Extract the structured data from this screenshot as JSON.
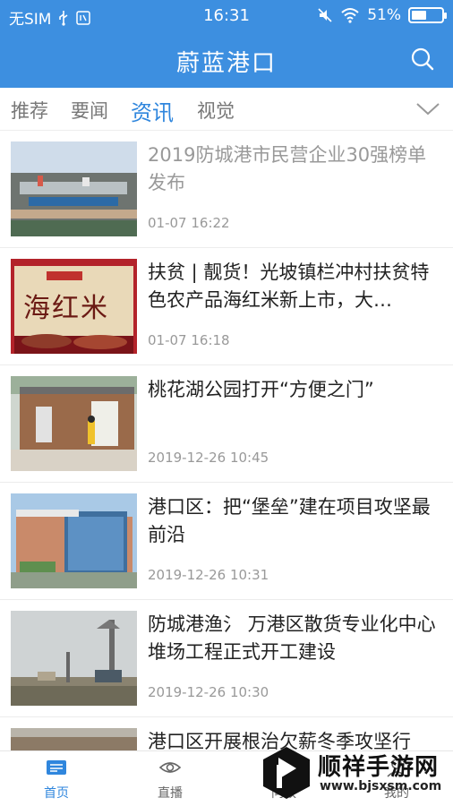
{
  "status_bar": {
    "carrier": "无SIM",
    "time": "16:31",
    "battery": "51%",
    "battery_level": 0.51
  },
  "header": {
    "title": "蔚蓝港口"
  },
  "tabs": [
    {
      "label": "推荐",
      "active": false
    },
    {
      "label": "要闻",
      "active": false
    },
    {
      "label": "资讯",
      "active": true
    },
    {
      "label": "视觉",
      "active": false
    }
  ],
  "articles": [
    {
      "title": "2019防城港市民营企业30强榜单发布",
      "time": "01-07 16:22",
      "read": true
    },
    {
      "title": "扶贫 | 靓货！光坡镇栏冲村扶贫特色农产品海红米新上市，大…",
      "time": "01-07 16:18",
      "read": false
    },
    {
      "title": "桃花湖公园打开“方便之门”",
      "time": "2019-12-26 10:45",
      "read": false
    },
    {
      "title": "港口区：把“堡垒”建在项目攻坚最前沿",
      "time": "2019-12-26 10:31",
      "read": false
    },
    {
      "title": "防城港渔氵 万港区散货专业化中心堆场工程正式开工建设",
      "time": "2019-12-26 10:30",
      "read": false
    },
    {
      "title": "港口区开展根治欠薪冬季攻坚行",
      "time": "",
      "read": false
    }
  ],
  "thumbnail_text": {
    "rice_label": "海红米"
  },
  "bottom_nav": [
    {
      "label": "首页",
      "active": true
    },
    {
      "label": "直播",
      "active": false
    },
    {
      "label": "问政",
      "active": false
    },
    {
      "label": "我的",
      "active": false
    }
  ],
  "watermark": {
    "name": "顺祥手游网",
    "url": "www.bjsxsm.com"
  },
  "colors": {
    "brand_blue": "#3d8fe0",
    "tab_active": "#2f86dd"
  }
}
